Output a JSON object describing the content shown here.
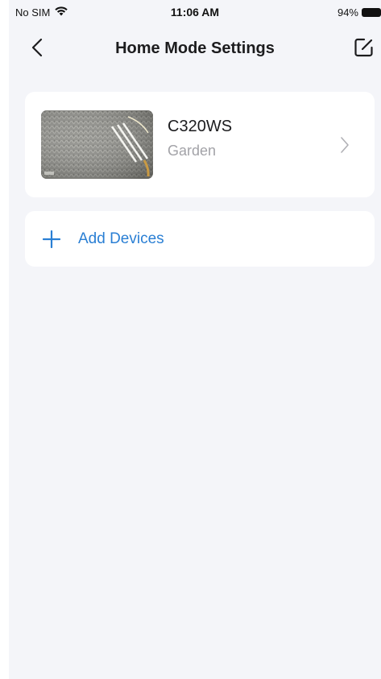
{
  "status_bar": {
    "carrier": "No SIM",
    "time": "11:06 AM",
    "battery": "94%"
  },
  "nav": {
    "title": "Home Mode Settings",
    "back_icon": "chevron-left-icon",
    "edit_icon": "edit-icon"
  },
  "device": {
    "name": "C320WS",
    "location": "Garden"
  },
  "add_devices": {
    "label": "Add Devices"
  },
  "colors": {
    "background": "#f4f5f9",
    "card": "#ffffff",
    "accent": "#2a7fd4",
    "secondary_text": "#a3a3a8"
  }
}
